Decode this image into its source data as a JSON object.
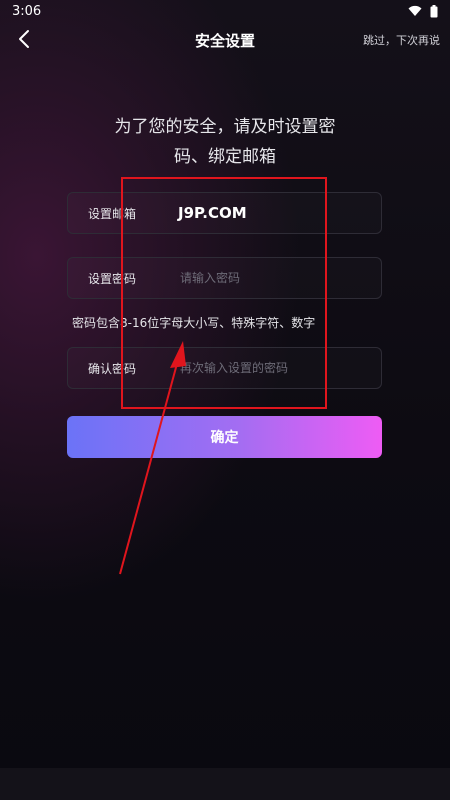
{
  "status_bar": {
    "time": "3:06",
    "icons": [
      "wifi-icon",
      "battery-icon"
    ]
  },
  "header": {
    "title": "安全设置",
    "skip_label": "跳过，下次再说"
  },
  "headline": {
    "line1": "为了您的安全，请及时设置密",
    "line2": "码、绑定邮箱"
  },
  "form": {
    "email": {
      "label": "设置邮箱",
      "value": "J9P.COM"
    },
    "password": {
      "label": "设置密码",
      "placeholder": "请输入密码"
    },
    "hint": "密码包含8-16位字母大小写、特殊字符、数字",
    "confirm_password": {
      "label": "确认密码",
      "placeholder": "再次输入设置的密码"
    },
    "submit_label": "确定"
  },
  "colors": {
    "button_gradient_start": "#6b73f7",
    "button_gradient_end": "#ee5cf4",
    "annotation": "#e0151d"
  }
}
